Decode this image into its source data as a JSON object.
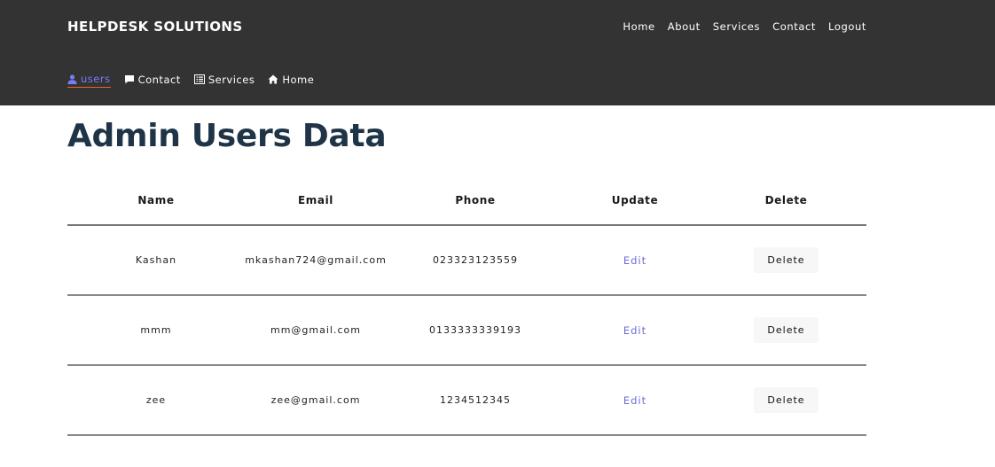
{
  "brand": "HELPDESK SOLUTIONS",
  "top_nav": [
    "Home",
    "About",
    "Services",
    "Contact",
    "Logout"
  ],
  "sub_nav": [
    {
      "label": "users",
      "icon": "user-icon",
      "active": true
    },
    {
      "label": "Contact",
      "icon": "message-icon",
      "active": false
    },
    {
      "label": "Services",
      "icon": "list-icon",
      "active": false
    },
    {
      "label": "Home",
      "icon": "home-icon",
      "active": false
    }
  ],
  "page_title": "Admin Users Data",
  "table": {
    "headers": [
      "Name",
      "Email",
      "Phone",
      "Update",
      "Delete"
    ],
    "rows": [
      {
        "name": "Kashan",
        "email": "mkashan724@gmail.com",
        "phone": "023323123559",
        "edit": "Edit",
        "delete": "Delete"
      },
      {
        "name": "mmm",
        "email": "mm@gmail.com",
        "phone": "0133333339193",
        "edit": "Edit",
        "delete": "Delete"
      },
      {
        "name": "zee",
        "email": "zee@gmail.com",
        "phone": "1234512345",
        "edit": "Edit",
        "delete": "Delete"
      }
    ]
  },
  "colors": {
    "header_bg": "#333333",
    "active_link": "#7b7bf5",
    "active_underline": "#e8662b",
    "title": "#1f3447",
    "edit_link": "#6b6bd8"
  }
}
